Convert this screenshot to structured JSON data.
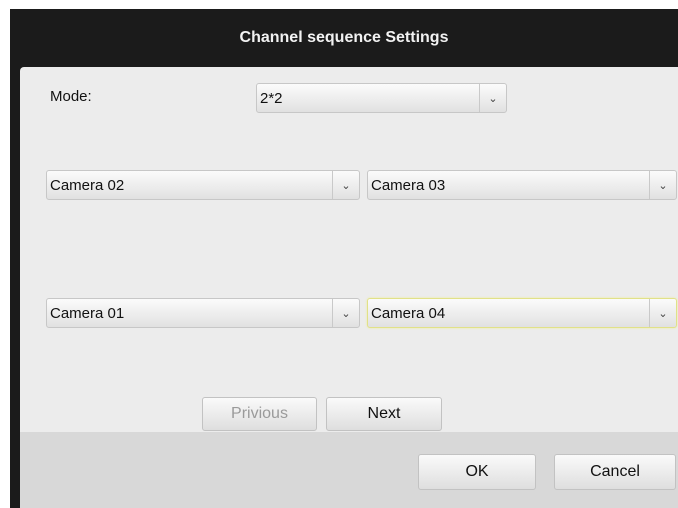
{
  "dialog": {
    "title": "Channel sequence Settings",
    "mode_label": "Mode:",
    "mode_value": "2*2",
    "channels": {
      "top_left": "Camera 02",
      "top_right": "Camera 03",
      "bottom_left": "Camera 01",
      "bottom_right": "Camera 04"
    },
    "pager": {
      "previous": "Privious",
      "next": "Next"
    },
    "buttons": {
      "ok": "OK",
      "cancel": "Cancel"
    }
  }
}
